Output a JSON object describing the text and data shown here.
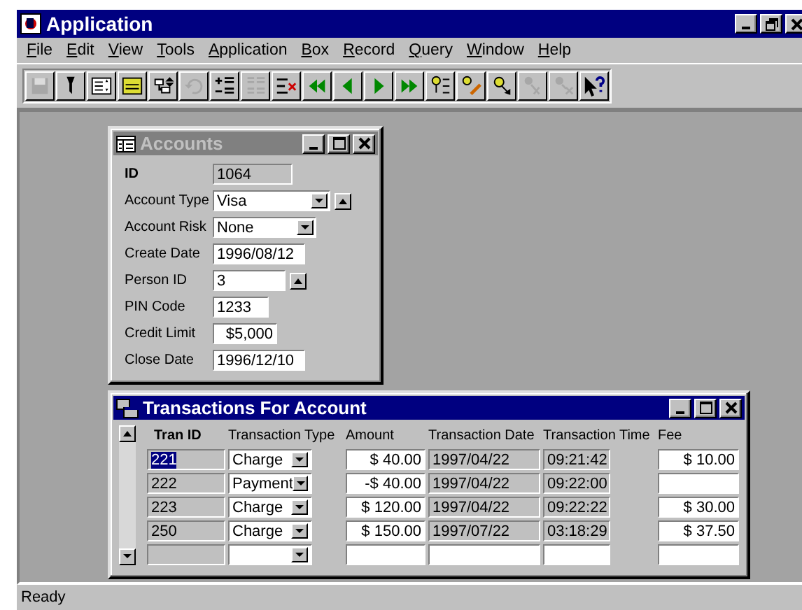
{
  "window": {
    "title": "Application"
  },
  "menu": [
    {
      "label": "File"
    },
    {
      "label": "Edit"
    },
    {
      "label": "View"
    },
    {
      "label": "Tools"
    },
    {
      "label": "Application"
    },
    {
      "label": "Box"
    },
    {
      "label": "Record"
    },
    {
      "label": "Query"
    },
    {
      "label": "Window"
    },
    {
      "label": "Help"
    }
  ],
  "toolbar": [
    {
      "disabled": true
    },
    {
      "disabled": false
    },
    {
      "disabled": false
    },
    {
      "disabled": false
    },
    {
      "disabled": false
    },
    {
      "disabled": true
    },
    {
      "disabled": false
    },
    {
      "disabled": true
    },
    {
      "disabled": false
    },
    {
      "disabled": false
    },
    {
      "disabled": false
    },
    {
      "disabled": false
    },
    {
      "disabled": false
    },
    {
      "disabled": false
    },
    {
      "disabled": false
    },
    {
      "disabled": false
    },
    {
      "disabled": true
    },
    {
      "disabled": true
    },
    {
      "disabled": false
    }
  ],
  "accounts": {
    "title": "Accounts",
    "active": false,
    "fields": [
      {
        "label": "ID",
        "kind": "readonly",
        "value": "1064"
      },
      {
        "label": "Account Type",
        "kind": "dropdown",
        "value": "Visa",
        "spin": true
      },
      {
        "label": "Account Risk",
        "kind": "dropdown",
        "value": "None",
        "spin": false
      },
      {
        "label": "Create Date",
        "kind": "text",
        "value": "1996/08/12"
      },
      {
        "label": "Person ID",
        "kind": "text",
        "value": "3",
        "spin": true
      },
      {
        "label": "PIN Code",
        "kind": "text",
        "value": "1233"
      },
      {
        "label": "Credit Limit",
        "kind": "currency",
        "value": "$5,000"
      },
      {
        "label": "Close Date",
        "kind": "text",
        "value": "1996/12/10"
      }
    ]
  },
  "transactions": {
    "title": "Transactions For Account",
    "active": true,
    "columns": [
      "Tran ID",
      "Transaction Type",
      "Amount",
      "Transaction Date",
      "Transaction Time",
      "Fee"
    ],
    "rows": [
      {
        "kind": "record",
        "selected": true,
        "tran_id": "221",
        "type": "Charge",
        "amount": "$  40.00",
        "date": "1997/04/22",
        "time": "09:21:42",
        "fee": "$  10.00"
      },
      {
        "kind": "record",
        "selected": false,
        "tran_id": "222",
        "type": "Payment",
        "amount": "-$  40.00",
        "date": "1997/04/22",
        "time": "09:22:00"
      },
      {
        "kind": "record",
        "selected": false,
        "tran_id": "223",
        "type": "Charge",
        "amount": "$  120.00",
        "date": "1997/04/22",
        "time": "09:22:22",
        "fee": "$  30.00"
      },
      {
        "kind": "record",
        "selected": false,
        "tran_id": "250",
        "type": "Charge",
        "amount": "$  150.00",
        "date": "1997/07/22",
        "time": "03:18:29",
        "fee": "$  37.50"
      },
      {
        "kind": "new",
        "selected": false
      }
    ]
  },
  "status_bar": {
    "text": "Ready"
  }
}
